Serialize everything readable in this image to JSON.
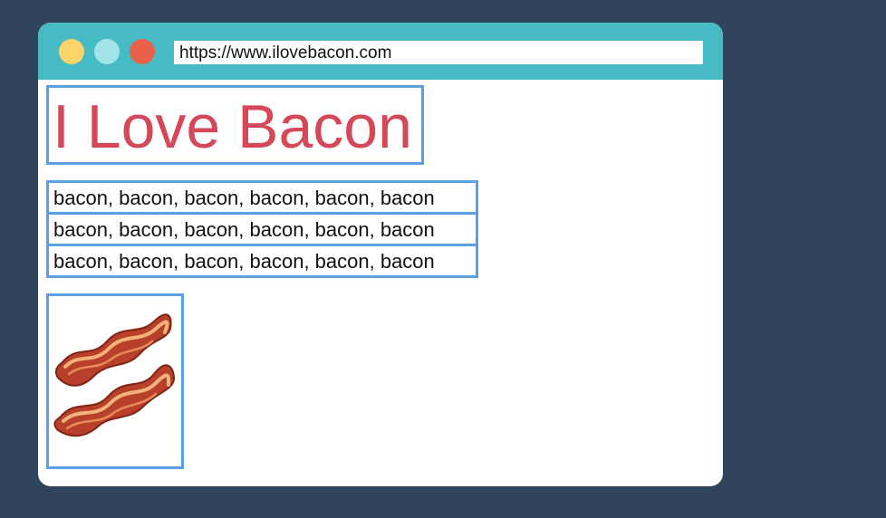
{
  "colors": {
    "background": "#30445e",
    "title_bar": "#47bbc4",
    "dot_yellow": "#fdd56b",
    "dot_cyan": "#a3e4e9",
    "dot_red": "#e9614a",
    "heading": "#d4485a",
    "element_outline": "#5aa0e6"
  },
  "browser": {
    "url": "https://www.ilovebacon.com"
  },
  "page": {
    "heading": "I Love Bacon",
    "paragraphs": [
      "bacon, bacon, bacon, bacon, bacon, bacon",
      "bacon, bacon, bacon, bacon, bacon, bacon",
      "bacon, bacon, bacon, bacon, bacon, bacon"
    ],
    "image_icon": "bacon-icon"
  }
}
